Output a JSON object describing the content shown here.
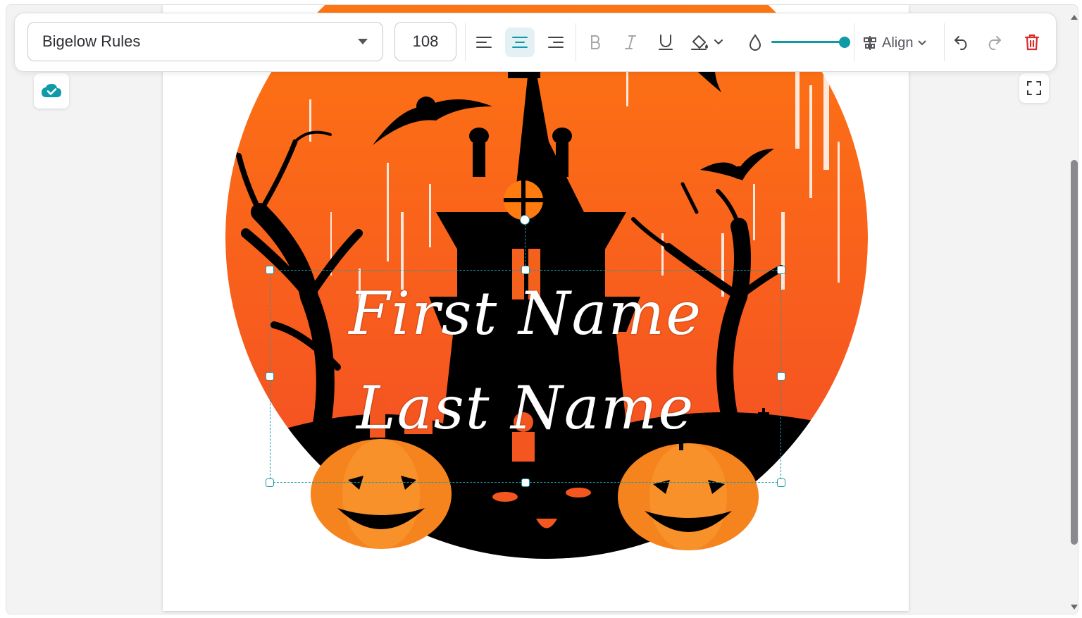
{
  "toolbar": {
    "font_family": "Bigelow Rules",
    "font_size": "108",
    "align_label": "Align",
    "text_align_active": "center",
    "opacity_percent": 100
  },
  "canvas": {
    "text_lines": [
      "First Name",
      "Last Name"
    ]
  },
  "colors": {
    "accent": "#0e9aa7",
    "delete": "#d92b2b",
    "orange_top": "#ff7b10",
    "orange_bottom": "#f34a26",
    "pumpkin": "#f5841f"
  }
}
